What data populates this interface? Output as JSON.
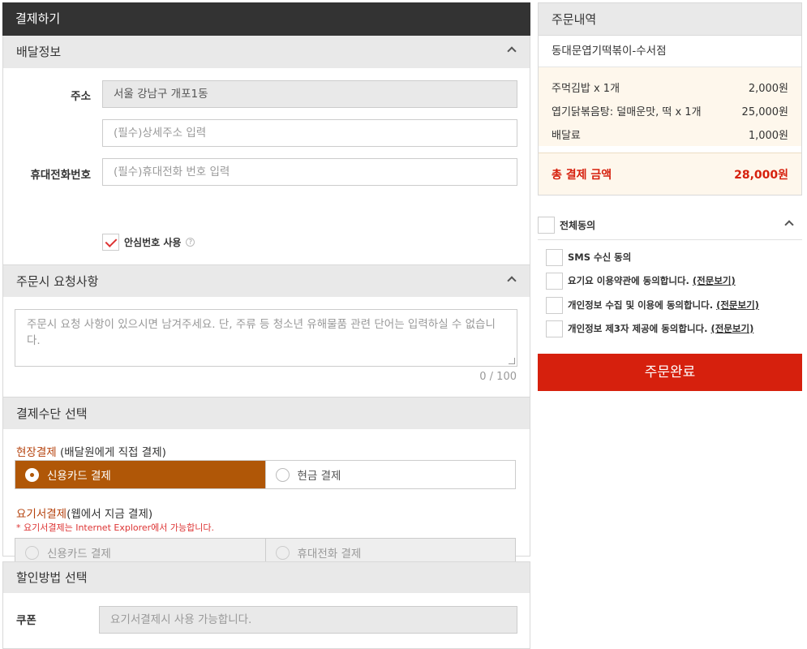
{
  "checkout": {
    "title": "결제하기",
    "delivery": {
      "header": "배달정보",
      "address_label": "주소",
      "address_value": "서울 강남구 개포1동",
      "detail_placeholder": "(필수)상세주소 입력",
      "phone_label": "휴대전화번호",
      "phone_placeholder": "(필수)휴대전화 번호 입력",
      "safe_number_label": "안심번호 사용",
      "safe_number_checked": true
    },
    "request": {
      "header": "주문시 요청사항",
      "placeholder": "주문시 요청 사항이 있으시면 남겨주세요. 단, 주류 등 청소년 유해물품 관련 단어는 입력하실 수 없습니다.",
      "counter": "0 / 100"
    },
    "payment": {
      "header": "결제수단 선택",
      "onsite_label_highlight": "현장결제",
      "onsite_label_rest": " (배달원에게 직접 결제)",
      "onsite_options": [
        "신용카드 결제",
        "현금 결제"
      ],
      "onsite_selected": 0,
      "online_label_highlight": "요기서결제",
      "online_label_rest": "(웹에서 지금 결제)",
      "online_note": "* 요기서결제는 Internet Explorer에서 가능합니다.",
      "online_options": [
        "신용카드 결제",
        "휴대전화 결제"
      ]
    },
    "discount": {
      "header": "할인방법 선택",
      "coupon_label": "쿠폰",
      "coupon_value": "요기서결제시 사용 가능합니다."
    }
  },
  "order": {
    "header": "주문내역",
    "shop": "동대문엽기떡볶이-수서점",
    "items": [
      {
        "name": "주먹김밥 x 1개",
        "price": "2,000원"
      },
      {
        "name": "엽기닭볶음탕: 덜매운맛, 떡 x 1개",
        "price": "25,000원"
      },
      {
        "name": "배달료",
        "price": "1,000원"
      }
    ],
    "total_label": "총 결제 금액",
    "total_value": "28,000원"
  },
  "agreements": {
    "all_label": "전체동의",
    "sms": "SMS 수신 동의",
    "terms": "요기요 이용약관에 동의합니다.",
    "privacy": "개인정보 수집 및 이용에 동의합니다.",
    "third_party": "개인정보 제3자 제공에 동의합니다.",
    "view_full": "(전문보기)"
  },
  "submit_label": "주문완료",
  "colors": {
    "accent_orange": "#b05707",
    "submit_red": "#d6200d",
    "header_dark": "#333333"
  }
}
